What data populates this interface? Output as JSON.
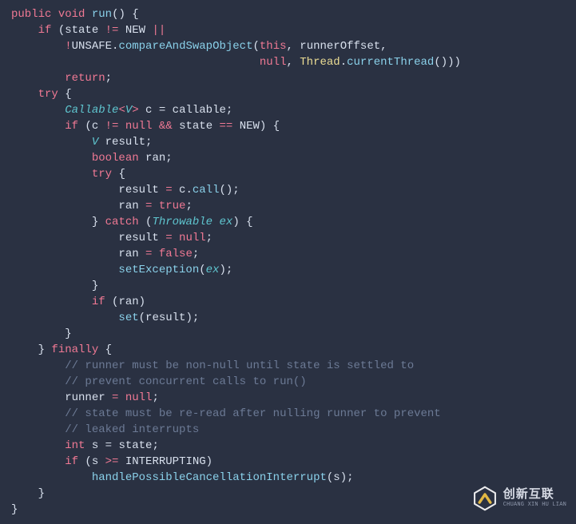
{
  "code": {
    "l01": {
      "public": "public",
      "void": "void",
      "run": "run",
      "open": "() {"
    },
    "l02": {
      "if": "if",
      "p1": "(state ",
      "ne": "!=",
      "p2": " NEW ",
      "or": "||"
    },
    "l03": {
      "bang": "!",
      "id": "UNSAFE",
      "dot": ".",
      "fn": "compareAndSwapObject",
      "p1": "(",
      "this": "this",
      "c1": ", runnerOffset,"
    },
    "l04": {
      "null": "null",
      "c": ", ",
      "type": "Thread",
      "dot": ".",
      "fn": "currentThread",
      "tail": "()))"
    },
    "l05": {
      "return": "return",
      "sc": ";"
    },
    "l06": {
      "try": "try",
      "b": " {"
    },
    "l07": {
      "type": "Callable",
      "lt": "<",
      "v": "V",
      "gt": ">",
      "rest": " c = callable;"
    },
    "l08": {
      "if": "if",
      "o": " (c ",
      "ne": "!=",
      "sp": " ",
      "null": "null",
      "sp2": " ",
      "and": "&&",
      "mid": " state ",
      "eq": "==",
      "tail": " NEW) {"
    },
    "l09": {
      "v": "V",
      "rest": " result;"
    },
    "l10": {
      "bool": "boolean",
      "rest": " ran;"
    },
    "l11": {
      "try": "try",
      "b": " {"
    },
    "l12": {
      "lhs": "result ",
      "eq": "=",
      "mid": " c.",
      "fn": "call",
      "tail": "();"
    },
    "l13": {
      "lhs": "ran ",
      "eq": "=",
      "sp": " ",
      "true": "true",
      "sc": ";"
    },
    "l14": {
      "close": "} ",
      "catch": "catch",
      "o": " (",
      "type": "Throwable",
      "ex": " ex",
      "tail": ") {"
    },
    "l15": {
      "lhs": "result ",
      "eq": "=",
      "sp": " ",
      "null": "null",
      "sc": ";"
    },
    "l16": {
      "lhs": "ran ",
      "eq": "=",
      "sp": " ",
      "false": "false",
      "sc": ";"
    },
    "l17": {
      "fn": "setException",
      "o": "(",
      "ex": "ex",
      "tail": ");"
    },
    "l18": {
      "c": "}"
    },
    "l19": {
      "if": "if",
      "rest": " (ran)"
    },
    "l20": {
      "fn": "set",
      "rest": "(result);"
    },
    "l21": {
      "c": "}"
    },
    "l22": {
      "close": "} ",
      "finally": "finally",
      "b": " {"
    },
    "l23": {
      "c": "// runner must be non-null until state is settled to"
    },
    "l24": {
      "c": "// prevent concurrent calls to run()"
    },
    "l25": {
      "lhs": "runner ",
      "eq": "=",
      "sp": " ",
      "null": "null",
      "sc": ";"
    },
    "l26": {
      "c": "// state must be re-read after nulling runner to prevent"
    },
    "l27": {
      "c": "// leaked interrupts"
    },
    "l28": {
      "int": "int",
      "rest": " s = state;"
    },
    "l29": {
      "if": "if",
      "o": " (s ",
      "ge": ">=",
      "tail": " INTERRUPTING)"
    },
    "l30": {
      "fn": "handlePossibleCancellationInterrupt",
      "rest": "(s);"
    },
    "l31": {
      "c": "}"
    },
    "l32": {
      "c": "}"
    }
  },
  "logo": {
    "cn": "创新互联",
    "en": "CHUANG XIN HU LIAN"
  }
}
